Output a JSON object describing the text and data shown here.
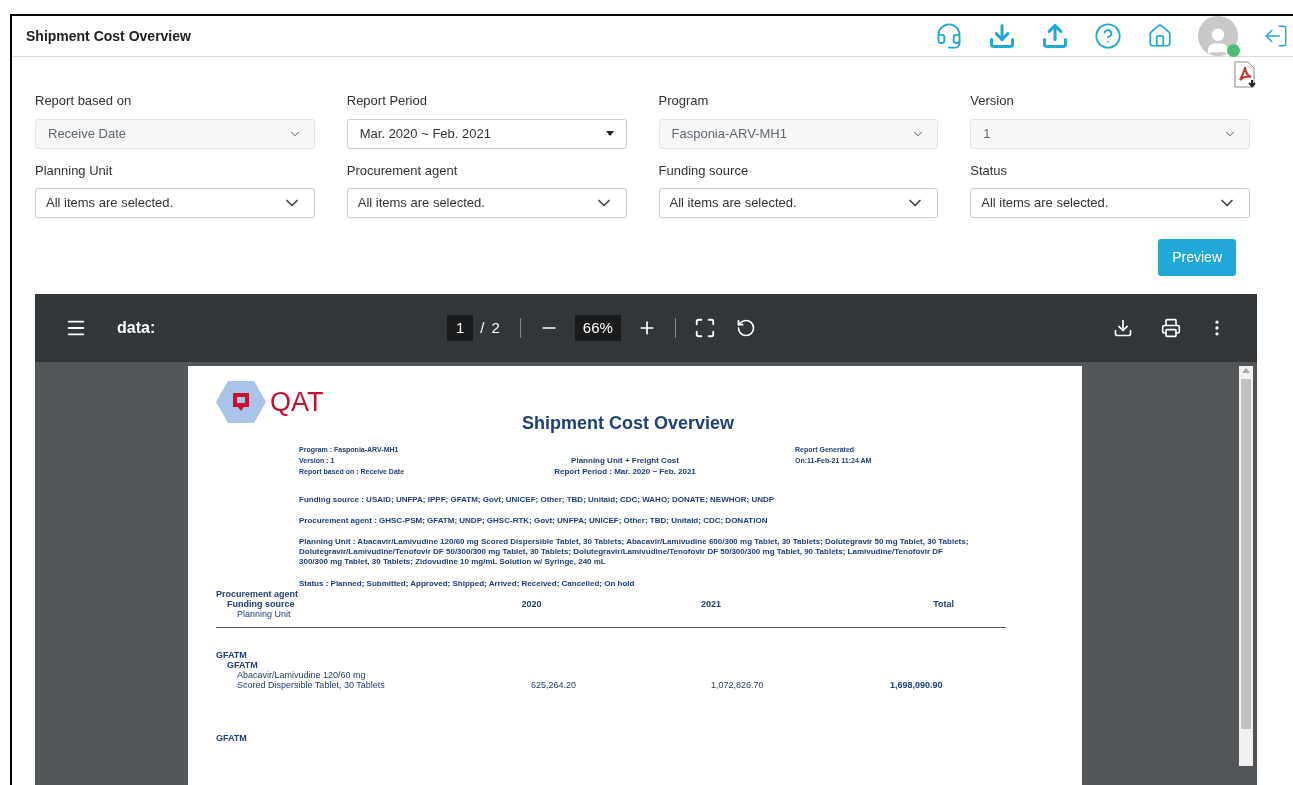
{
  "header": {
    "title": "Shipment Cost Overview"
  },
  "filters": [
    {
      "label": "Report based on",
      "value": "Receive Date",
      "kind": "select",
      "disabled": true
    },
    {
      "label": "Report Period",
      "value": "Mar. 2020 ~ Feb. 2021",
      "kind": "picker",
      "disabled": false
    },
    {
      "label": "Program",
      "value": "Fasponia-ARV-MH1",
      "kind": "select",
      "disabled": true
    },
    {
      "label": "Version",
      "value": "1",
      "kind": "select",
      "disabled": true
    },
    {
      "label": "Planning Unit",
      "value": "All items are selected.",
      "kind": "multi",
      "disabled": false
    },
    {
      "label": "Procurement agent",
      "value": "All items are selected.",
      "kind": "multi",
      "disabled": false
    },
    {
      "label": "Funding source",
      "value": "All items are selected.",
      "kind": "multi",
      "disabled": false
    },
    {
      "label": "Status",
      "value": "All items are selected.",
      "kind": "multi",
      "disabled": false
    }
  ],
  "preview_button": "Preview",
  "viewer": {
    "title": "data:",
    "page": "1",
    "separator": "/",
    "pages": "2",
    "zoom": "66%"
  },
  "document": {
    "logo": "QAT",
    "title": "Shipment Cost Overview",
    "meta_left": [
      "Program : Fasponia-ARV-MH1",
      "Version : 1",
      "Report based on : Receive Date"
    ],
    "meta_center": [
      "Planning Unit + Freight Cost",
      "Report Period : Mar. 2020 ~ Feb. 2021"
    ],
    "meta_right": [
      "Report Generated",
      "On:11-Feb-21 11:24 AM"
    ],
    "criteria": [
      "Funding source : USAID; UNFPA; IPPF; GFATM; Govt; UNICEF; Other; TBD; Unitaid; CDC; WAHO; DONATE; NEWHOR; UNDP",
      "Procurement agent : GHSC-PSM; GFATM; UNDP; GHSC-RTK; Govt; UNFPA; UNICEF; Other; TBD; Unitaid; CDC; DONATION",
      "Planning Unit : Abacavir/Lamivudine 120/60 mg Scored Dispersible Tablet, 30 Tablets; Abacavir/Lamivudine 600/300 mg Tablet, 30 Tablets; Dolutegravir 50 mg Tablet, 30 Tablets; Dolutegravir/Lamivudine/Tenofovir DF 50/300/300 mg Tablet, 30 Tablets; Dolutegravir/Lamivudine/Tenofovir DF 50/300/300 mg Tablet, 90 Tablets; Lamivudine/Tenofovir DF 300/300 mg Tablet, 30 Tablets; Zidovudine 10 mg/mL Solution w/ Syringe, 240 mL"
    ],
    "status_line": "Status : Planned; Submitted; Approved; Shipped; Arrived; Received; Cancelled; On hold",
    "table": {
      "levels": [
        "Procurement agent",
        "Funding source",
        "Planning Unit"
      ],
      "columns": [
        "2020",
        "2021",
        "Total"
      ],
      "groups": [
        {
          "agent": "GFATM",
          "funding": "GFATM",
          "unit": [
            "Abacavir/Lamivudine 120/60 mg",
            "Scored Dispersible Tablet, 30 Tablets"
          ],
          "values": [
            "625,264.20",
            "1,072,826.70",
            "1,698,090.90"
          ]
        }
      ],
      "next_agent": "GFATM"
    }
  }
}
